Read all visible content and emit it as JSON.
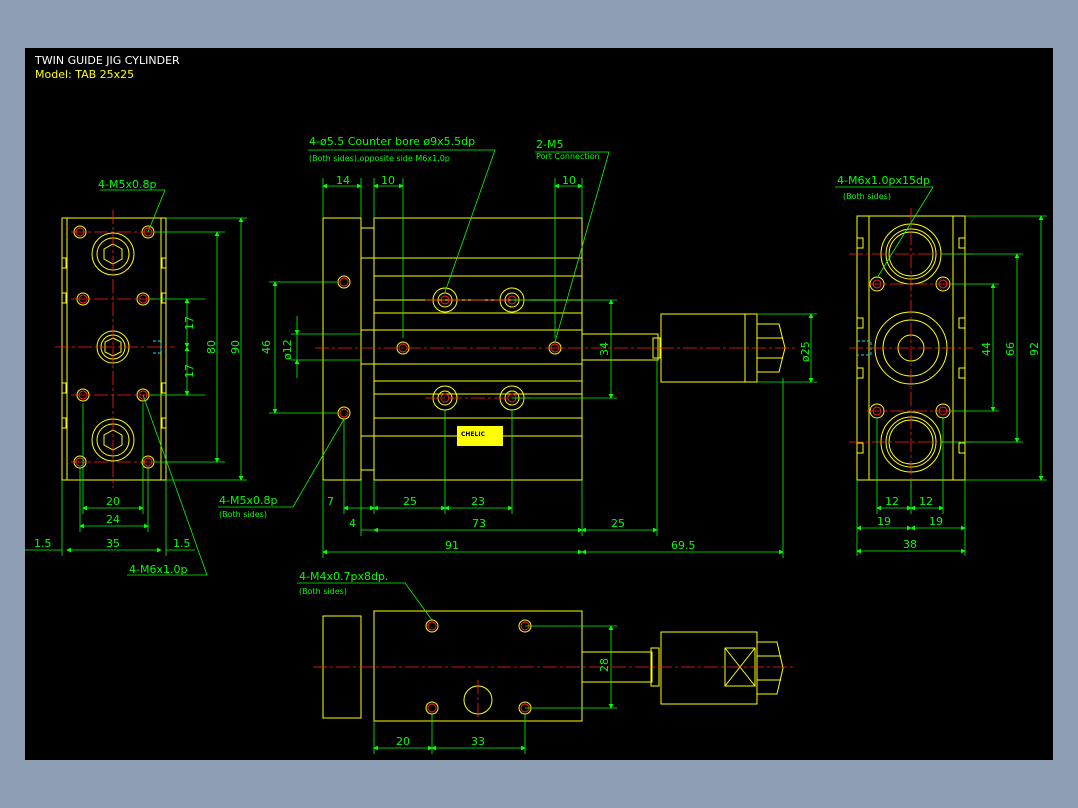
{
  "title_block": {
    "title": "TWIN GUIDE JIG CYLINDER",
    "model": "Model: TAB 25x25"
  },
  "colors": {
    "background": "#000000",
    "outline": "#ffff00",
    "dimension": "#00ff00",
    "centerline": "#ff2020",
    "hidden": "#00e5ff",
    "title": "#ffffff"
  },
  "left_view": {
    "top_note": "4-M5x0.8p",
    "bottom_note": "4-M6x1.0p",
    "dims": {
      "d17a": "17",
      "d17b": "17",
      "d80": "80",
      "d90": "90",
      "d20": "20",
      "d24": "24",
      "d35": "35",
      "d1_5a": "1.5",
      "d1_5b": "1.5"
    }
  },
  "front_view": {
    "note_bore": "4-ø5.5 Counter bore ø9x5.5dp",
    "note_bore_sub": "(Both sides),opposite side M6x1.0p",
    "note_port": "2-M5",
    "note_port_sub": "Port Connection",
    "note_side": "4-M5x0.8p",
    "note_side_sub": "(Both sides)",
    "logo": "CHELIC",
    "dims": {
      "d14": "14",
      "d10a": "10",
      "d10b": "10",
      "d46": "46",
      "d12": "ø12",
      "d34": "34",
      "d25dia": "ø25",
      "d7": "7",
      "d4": "4",
      "d25a": "25",
      "d23": "23",
      "d73": "73",
      "d25b": "25",
      "d91": "91",
      "d69_5": "69.5"
    }
  },
  "right_view": {
    "note": "4-M6x1.0px15dp",
    "note_sub": "(Both sides)",
    "dims": {
      "d44": "44",
      "d66": "66",
      "d92": "92",
      "d12a": "12",
      "d12b": "12",
      "d19a": "19",
      "d19b": "19",
      "d38": "38"
    }
  },
  "bottom_view": {
    "note": "4-M4x0.7px8dp.",
    "note_sub": "(Both sides)",
    "dims": {
      "d28": "28",
      "d20": "20",
      "d33": "33"
    }
  }
}
